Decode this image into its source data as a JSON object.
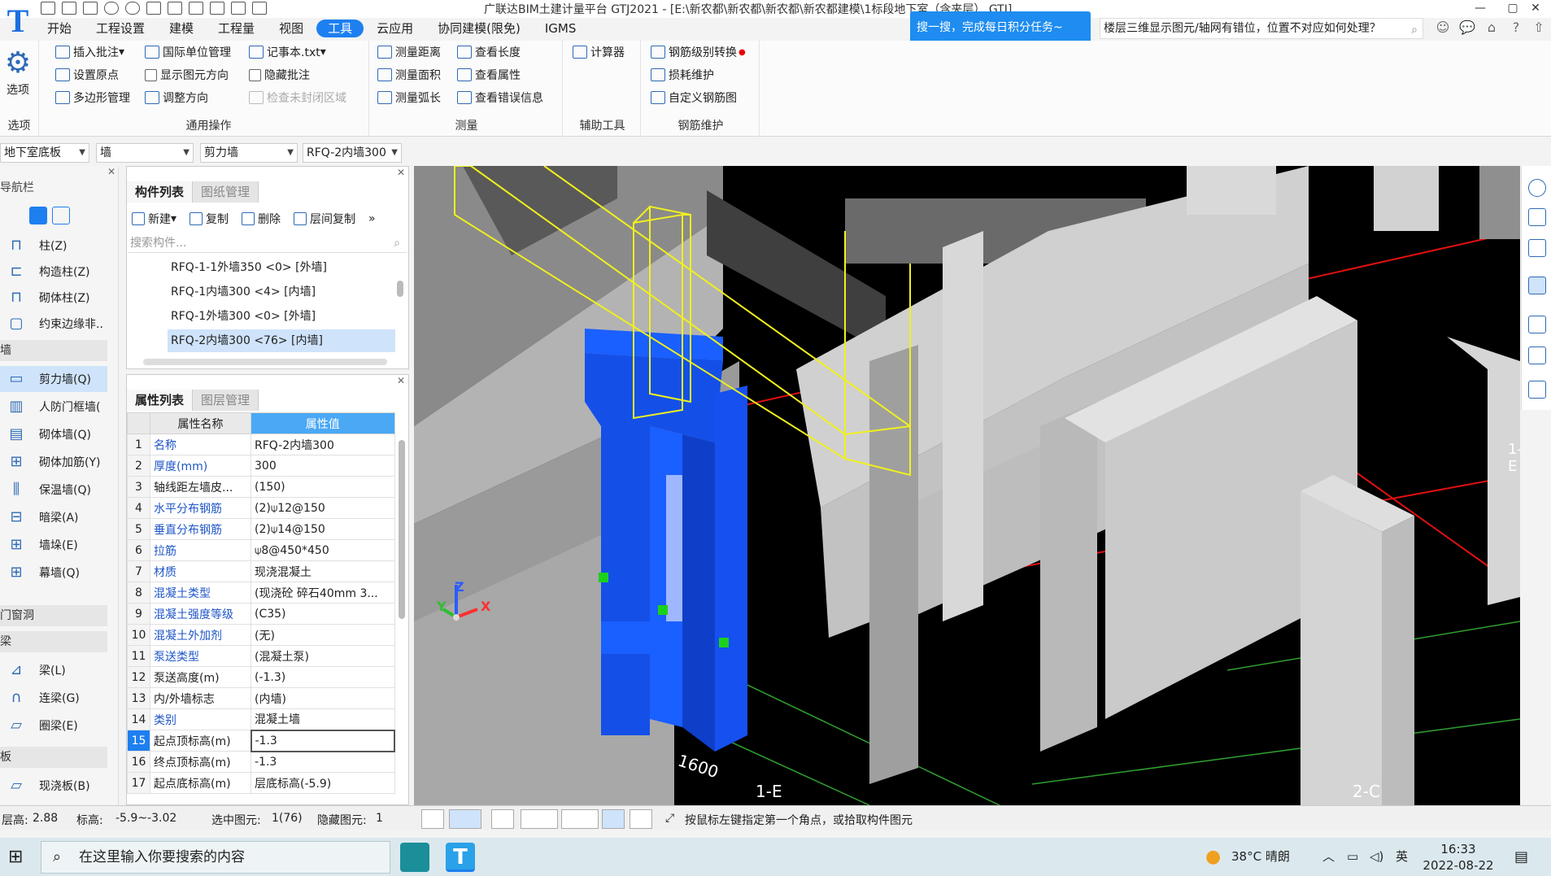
{
  "window": {
    "title": "广联达BIM土建计量平台 GTJ2021 - [E:\\新农都\\新农都\\新农都\\新农都建模\\1标段地下室（含夹层）.GTJ]",
    "controls": [
      "—",
      "▢",
      "✕"
    ]
  },
  "ribbon_tabs": [
    "开始",
    "工程设置",
    "建模",
    "工程量",
    "视图",
    "工具",
    "云应用",
    "协同建模(限免)",
    "IGMS"
  ],
  "active_tab": "工具",
  "promo": "搜一搜，完成每日积分任务~",
  "help_search": "楼层三维显示图元/轴网有错位，位置不对应如何处理？",
  "right_icons": [
    "☺",
    "💬",
    "⌂",
    "?",
    "⇧"
  ],
  "ribbon": {
    "options": "选项",
    "options_group": "选项",
    "general": {
      "label": "通用操作",
      "items": [
        "插入批注",
        "国际单位管理",
        "记事本.txt",
        "设置原点",
        "显示图元方向",
        "隐藏批注",
        "多边形管理",
        "调整方向",
        "检查未封闭区域"
      ]
    },
    "measure": {
      "label": "测量",
      "items": [
        "测量距离",
        "查看长度",
        "测量面积",
        "查看属性",
        "测量弧长",
        "查看错误信息"
      ]
    },
    "aux": {
      "label": "辅助工具",
      "items": [
        "计算器"
      ]
    },
    "rebar": {
      "label": "钢筋维护",
      "items": [
        "钢筋级别转换",
        "损耗维护",
        "自定义钢筋图"
      ]
    }
  },
  "selectors": [
    "地下室底板",
    "墙",
    "剪力墙",
    "RFQ-2内墙300"
  ],
  "leftnav": {
    "title": "导航栏",
    "categories": [
      "墙",
      "门窗洞",
      "梁",
      "板"
    ],
    "wall_items": [
      "柱(Z)",
      "构造柱(Z)",
      "砌体柱(Z)",
      "约束边缘非..",
      "剪力墙(Q)",
      "人防门框墙(",
      "砌体墙(Q)",
      "砌体加筋(Y)",
      "保温墙(Q)",
      "暗梁(A)",
      "墙垛(E)",
      "幕墙(Q)"
    ],
    "beam_items": [
      "梁(L)",
      "连梁(G)",
      "圈梁(E)"
    ],
    "slab_items": [
      "现浇板(B)"
    ]
  },
  "component_panel": {
    "tabs": [
      "构件列表",
      "图纸管理"
    ],
    "tools": [
      "新建",
      "复制",
      "删除",
      "层间复制"
    ],
    "search_placeholder": "搜索构件...",
    "items": [
      "RFQ-1-1外墙350 <0> [外墙]",
      "RFQ-1内墙300 <4> [内墙]",
      "RFQ-1外墙300 <0> [外墙]",
      "RFQ-2内墙300 <76> [内墙]"
    ],
    "selected_index": 3
  },
  "property_panel": {
    "tabs": [
      "属性列表",
      "图层管理"
    ],
    "headers": [
      "属性名称",
      "属性值"
    ],
    "rows": [
      {
        "n": "1",
        "name": "名称",
        "value": "RFQ-2内墙300",
        "link": true
      },
      {
        "n": "2",
        "name": "厚度(mm)",
        "value": "300",
        "link": true
      },
      {
        "n": "3",
        "name": "轴线距左墙皮...",
        "value": "(150)",
        "link": false
      },
      {
        "n": "4",
        "name": "水平分布钢筋",
        "value": "(2)⍦12@150",
        "link": true
      },
      {
        "n": "5",
        "name": "垂直分布钢筋",
        "value": "(2)⍦14@150",
        "link": true
      },
      {
        "n": "6",
        "name": "拉筋",
        "value": "⍦8@450*450",
        "link": true
      },
      {
        "n": "7",
        "name": "材质",
        "value": "现浇混凝土",
        "link": true
      },
      {
        "n": "8",
        "name": "混凝土类型",
        "value": "(现浇砼 碎石40mm 3...",
        "link": true
      },
      {
        "n": "9",
        "name": "混凝土强度等级",
        "value": "(C35)",
        "link": true
      },
      {
        "n": "10",
        "name": "混凝土外加剂",
        "value": "(无)",
        "link": true
      },
      {
        "n": "11",
        "name": "泵送类型",
        "value": "(混凝土泵)",
        "link": true
      },
      {
        "n": "12",
        "name": "泵送高度(m)",
        "value": "(-1.3)",
        "link": false
      },
      {
        "n": "13",
        "name": "内/外墙标志",
        "value": "(内墙)",
        "link": false
      },
      {
        "n": "14",
        "name": "类别",
        "value": "混凝土墙",
        "link": true
      },
      {
        "n": "15",
        "name": "起点顶标高(m)",
        "value": "-1.3",
        "link": false
      },
      {
        "n": "16",
        "name": "终点顶标高(m)",
        "value": "-1.3",
        "link": false
      },
      {
        "n": "17",
        "name": "起点底标高(m)",
        "value": "层底标高(-5.9)",
        "link": false
      }
    ],
    "active_row": 14
  },
  "viewport": {
    "dimension_label": "1600",
    "axis_labels": [
      "1-E",
      "2-C",
      "1-E"
    ],
    "axis_letters": [
      "Z",
      "Y",
      "X"
    ]
  },
  "status": {
    "layer_height_label": "层高:",
    "layer_height": "2.88",
    "elev_label": "标高:",
    "elev": "-5.9~-3.02",
    "selected_label": "选中图元:",
    "selected": "1(76)",
    "hidden_label": "隐藏图元:",
    "hidden": "1",
    "hint": "按鼠标左键指定第一个角点，或拾取构件图元"
  },
  "taskbar": {
    "search_placeholder": "在这里输入你要搜索的内容",
    "weather": "38°C 晴朗",
    "ime": "英",
    "time": "16:33",
    "date": "2022-08-22"
  },
  "colors": {
    "accent": "#1d7ff0",
    "selected_wall": "#1450e8",
    "highlight_outline": "#f0f01e",
    "grid_red": "#e01010",
    "grid_green": "#2fa02f"
  }
}
